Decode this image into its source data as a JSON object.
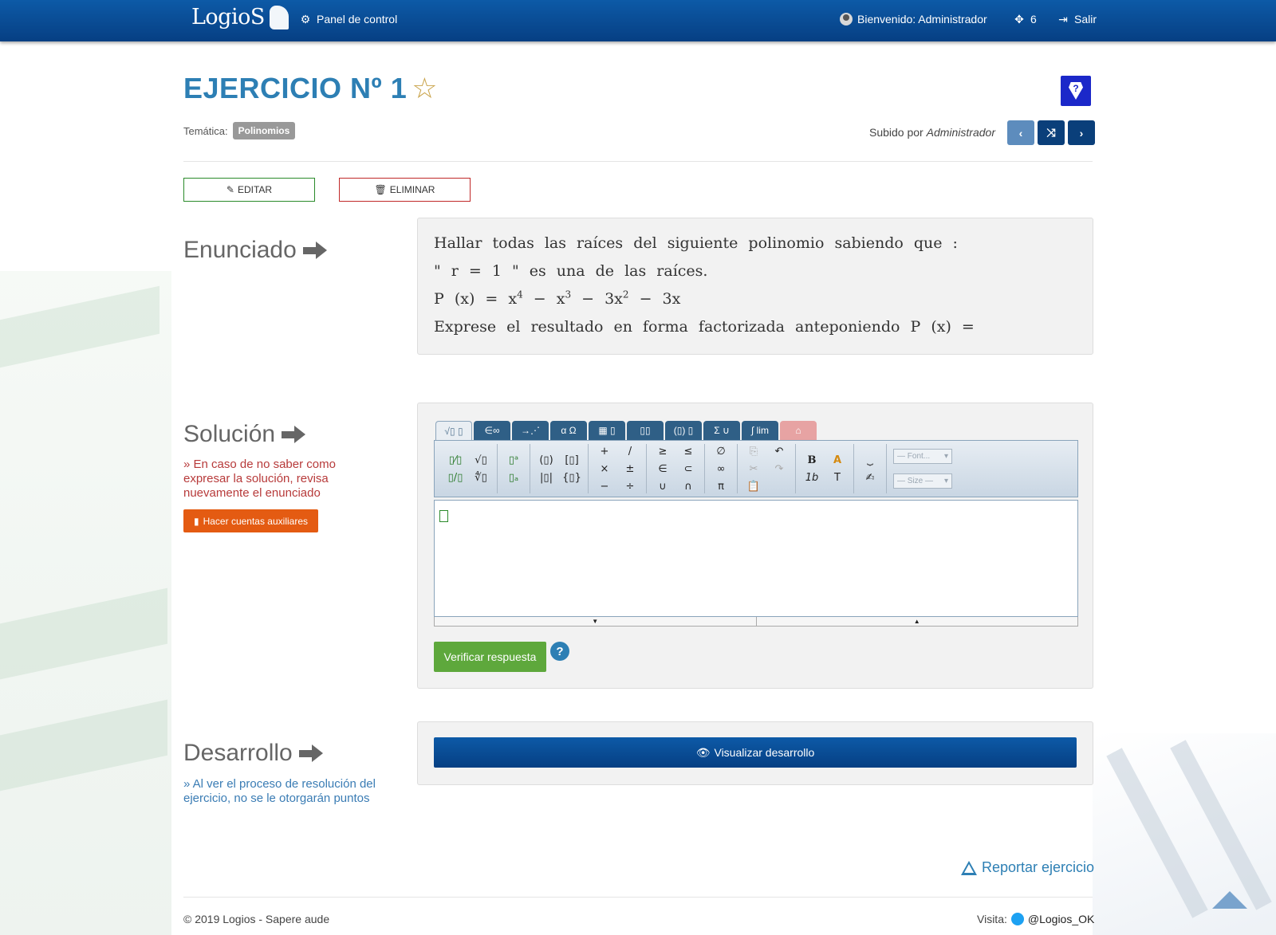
{
  "navbar": {
    "brand": "LogioS",
    "panel_label": "Panel de control",
    "welcome_label": "Bienvenido: Administrador",
    "count": "6",
    "logout_label": "Salir"
  },
  "exercise": {
    "title": "EJERCICIO Nº 1",
    "tematica_label": "Temática:",
    "tag": "Polinomios",
    "uploaded_by_prefix": "Subido por",
    "uploaded_by": "Administrador",
    "edit_label": "EDITAR",
    "delete_label": "ELIMINAR"
  },
  "enunciado": {
    "heading": "Enunciado",
    "line1": "Hallar todas las raíces del siguiente polinomio sabiendo que :",
    "line2": "\" r = 1 \" es una de las raíces.",
    "line3_prefix": "P (x) = x",
    "line3_exp1": "4",
    "line3_mid1": " − x",
    "line3_exp2": "3",
    "line3_mid2": " − 3x",
    "line3_exp3": "2",
    "line3_suffix": " − 3x",
    "line4": "Exprese el resultado en forma factorizada anteponiendo P (x) ="
  },
  "solucion": {
    "heading": "Solución",
    "note": "» En caso de no saber como expresar la solución, revisa nuevamente el enunciado",
    "aux_button": "Hacer cuentas auxiliares",
    "tabs": [
      "√▯ ▯",
      "∈∞",
      "→⋰",
      "α Ω",
      "▦ ▯",
      "▯▯",
      "(▯) ▯",
      "Σ ∪",
      "∫ lim",
      "⌂"
    ],
    "font_select": "— Font...",
    "size_select": "— Size —",
    "verify_button": "Verificar respuesta"
  },
  "desarrollo": {
    "heading": "Desarrollo",
    "note": "» Al ver el proceso de resolución del ejercicio, no se le otorgarán puntos",
    "button": "Visualizar desarrollo"
  },
  "report_label": "Reportar ejercicio",
  "footer": {
    "copyright": "© 2019 Logios - Sapere aude",
    "visit_label": "Visita:",
    "twitter_handle": "@Logios_OK"
  },
  "colors": {
    "navbar": "#0d5aa7",
    "title": "#2d7fb4",
    "edit_border": "#2a8a2a",
    "delete_border": "#c02828",
    "aux_button": "#e45b12",
    "verify_button": "#5ea83c",
    "help_badge": "#1b28c9"
  }
}
